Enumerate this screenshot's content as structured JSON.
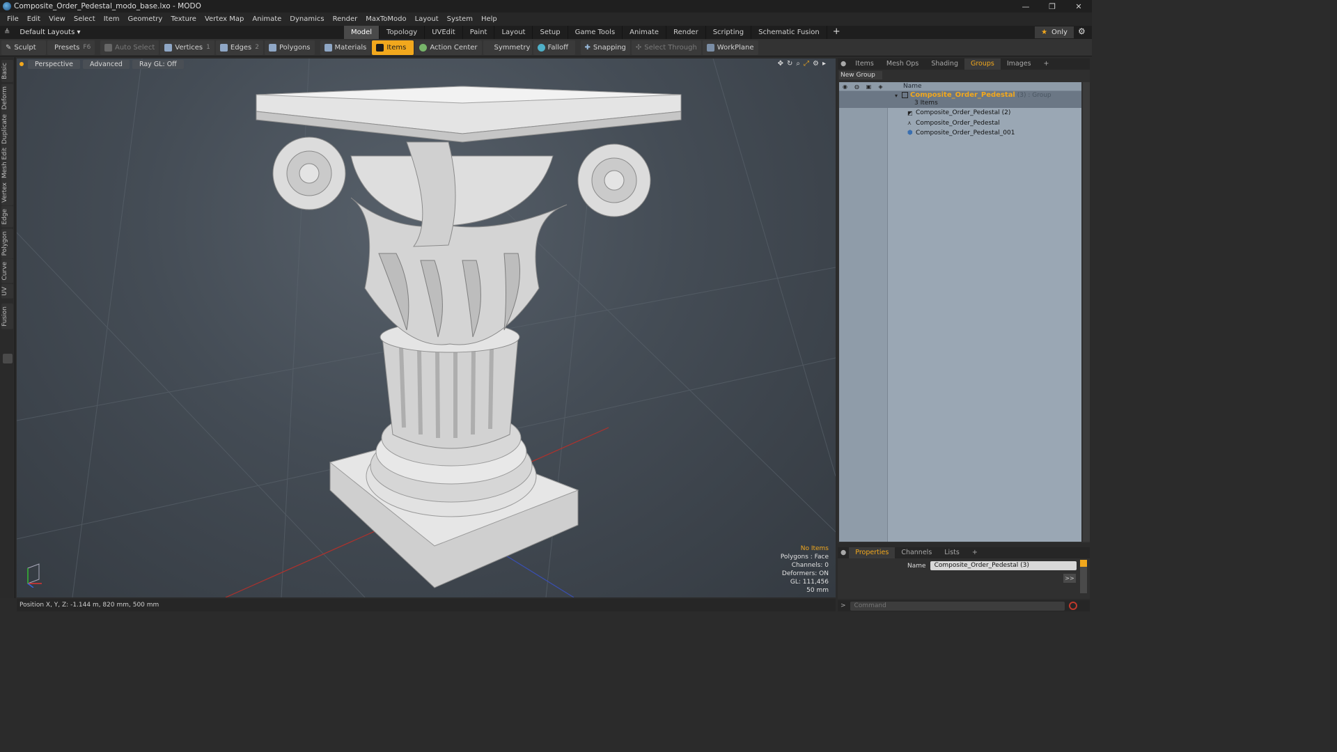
{
  "window": {
    "title": "Composite_Order_Pedestal_modo_base.lxo - MODO",
    "controls": [
      "—",
      "❐",
      "✕"
    ]
  },
  "menu": [
    "File",
    "Edit",
    "View",
    "Select",
    "Item",
    "Geometry",
    "Texture",
    "Vertex Map",
    "Animate",
    "Dynamics",
    "Render",
    "MaxToModo",
    "Layout",
    "System",
    "Help"
  ],
  "layout_bar": {
    "layout_label": "Default Layouts ▾",
    "tabs": [
      "Model",
      "Topology",
      "UVEdit",
      "Paint",
      "Layout",
      "Setup",
      "Game Tools",
      "Animate",
      "Render",
      "Scripting",
      "Schematic Fusion"
    ],
    "active_tab": "Model",
    "add_tab": "+",
    "only_label": "Only"
  },
  "toolbar": {
    "sculpt": "Sculpt",
    "presets": "Presets",
    "presets_key": "F6",
    "auto_select": "Auto Select",
    "vertices": "Vertices",
    "vertices_key": "1",
    "edges": "Edges",
    "edges_key": "2",
    "polygons": "Polygons",
    "materials": "Materials",
    "items": "Items",
    "action_center": "Action Center",
    "symmetry": "Symmetry",
    "falloff": "Falloff",
    "snapping": "Snapping",
    "select_through": "Select Through",
    "workplane": "WorkPlane"
  },
  "left_tabs": [
    "Basic",
    "Deform",
    "Duplicate",
    "Mesh Edit",
    "Vertex",
    "Edge",
    "Polygon",
    "Curve",
    "UV",
    "Fusion"
  ],
  "viewport": {
    "view_mode": "Perspective",
    "shading": "Advanced",
    "raygl": "Ray GL: Off",
    "stats": {
      "items": "No Items",
      "polygons": "Polygons : Face",
      "channels": "Channels: 0",
      "deformers": "Deformers: ON",
      "gl": "GL: 111,456",
      "scale": "50 mm"
    }
  },
  "status": {
    "position": "Position X, Y, Z:  -1.144 m, 820 mm, 500 mm"
  },
  "right_panel": {
    "tabs": [
      "Items",
      "Mesh Ops",
      "Shading",
      "Groups",
      "Images",
      "+"
    ],
    "active_tab": "Groups",
    "new_group": "New Group",
    "column_name": "Name",
    "group": {
      "name": "Composite_Order_Pedestal",
      "suffix": " (3) : Group",
      "count": "3 Items"
    },
    "children": [
      "Composite_Order_Pedestal (2)",
      "Composite_Order_Pedestal",
      "Composite_Order_Pedestal_001"
    ]
  },
  "properties": {
    "tabs": [
      "Properties",
      "Channels",
      "Lists",
      "+"
    ],
    "active_tab": "Properties",
    "name_label": "Name",
    "name_value": "Composite_Order_Pedestal (3)",
    "more": ">>"
  },
  "command": {
    "placeholder": "Command"
  },
  "colors": {
    "accent": "#f2a81d",
    "viewport_bg": "#444c55",
    "list_bg": "#9aa7b4"
  }
}
